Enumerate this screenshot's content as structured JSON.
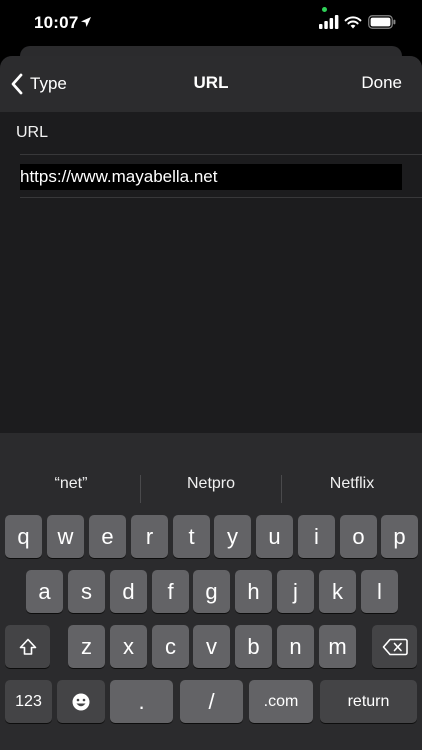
{
  "status": {
    "time": "10:07"
  },
  "nav": {
    "back_label": "Type",
    "title": "URL",
    "done_label": "Done"
  },
  "field": {
    "label": "URL",
    "value": "https://www.mayabella.net"
  },
  "keyboard": {
    "suggestions": [
      "“net”",
      "Netpro",
      "Netflix"
    ],
    "row1": [
      "q",
      "w",
      "e",
      "r",
      "t",
      "y",
      "u",
      "i",
      "o",
      "p"
    ],
    "row2": [
      "a",
      "s",
      "d",
      "f",
      "g",
      "h",
      "j",
      "k",
      "l"
    ],
    "row3": [
      "z",
      "x",
      "c",
      "v",
      "b",
      "n",
      "m"
    ],
    "numbers_label": "123",
    "dot_label": ".",
    "slash_label": "/",
    "dotcom_label": ".com",
    "return_label": "return"
  },
  "icons": [
    "location-arrow-icon",
    "signal-icon",
    "wifi-icon",
    "battery-icon",
    "chevron-left-icon",
    "shift-icon",
    "delete-icon",
    "emoji-icon"
  ]
}
